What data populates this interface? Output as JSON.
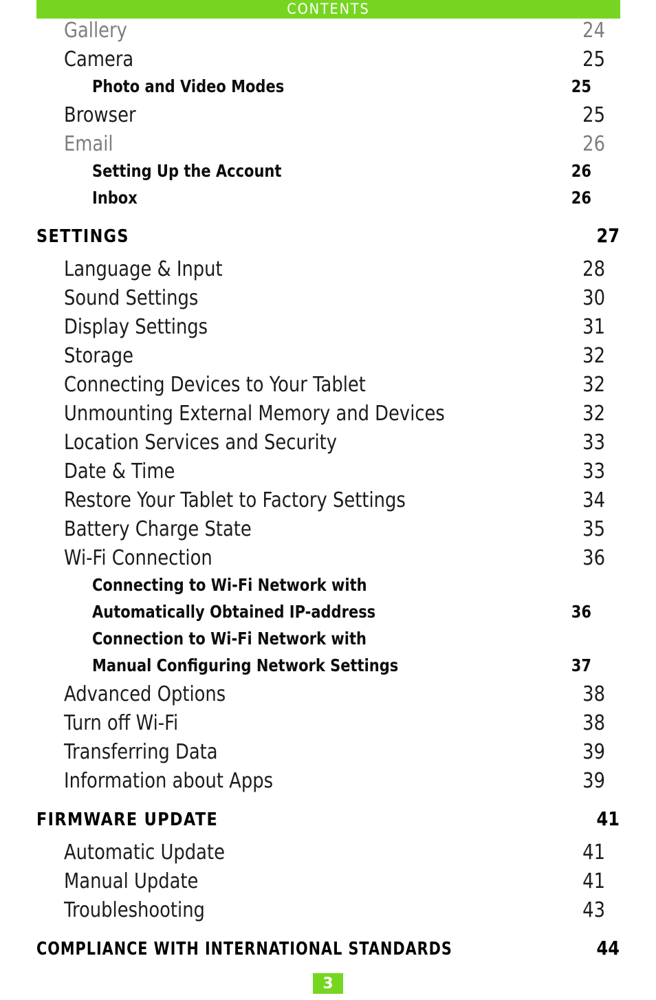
{
  "header": {
    "title": "CONTENTS",
    "bar_color": "#76d521",
    "text_color": "#ffffff"
  },
  "colors": {
    "accent_green": "#76d521",
    "text_dark": "#1c1c1c",
    "text_muted": "#7e7e7e",
    "badge_text": "#ffffff"
  },
  "entries": [
    {
      "level": 1,
      "label": "Gallery",
      "page": "24",
      "muted": true
    },
    {
      "level": 1,
      "label": "Camera",
      "page": "25",
      "muted": false
    },
    {
      "level": 2,
      "label": "Photo and Video Modes",
      "page": "25"
    },
    {
      "level": 1,
      "label": "Browser",
      "page": "25",
      "muted": false
    },
    {
      "level": 1,
      "label": "Email",
      "page": "26",
      "muted": true
    },
    {
      "level": 2,
      "label": "Setting Up the Account",
      "page": "26"
    },
    {
      "level": 2,
      "label": "Inbox",
      "page": "26"
    },
    {
      "level": 0,
      "label": "SETTINGS",
      "page": "27"
    },
    {
      "level": 1,
      "label": "Language & Input",
      "page": "28",
      "muted": false
    },
    {
      "level": 1,
      "label": "Sound Settings",
      "page": "30",
      "muted": false
    },
    {
      "level": 1,
      "label": "Display Settings",
      "page": "31",
      "muted": false
    },
    {
      "level": 1,
      "label": "Storage",
      "page": "32",
      "muted": false
    },
    {
      "level": 1,
      "label": "Connecting Devices to Your Tablet",
      "page": "32",
      "muted": false
    },
    {
      "level": 1,
      "label": "Unmounting External Memory and Devices",
      "page": "32",
      "muted": false
    },
    {
      "level": 1,
      "label": "Location Services and Security",
      "page": "33",
      "muted": false
    },
    {
      "level": 1,
      "label": "Date & Time",
      "page": "33",
      "muted": false
    },
    {
      "level": 1,
      "label": "Restore Your Tablet to Factory Settings",
      "page": "34",
      "muted": false
    },
    {
      "level": 1,
      "label": "Battery Charge State",
      "page": "35",
      "muted": false
    },
    {
      "level": 1,
      "label": "Wi-Fi Connection",
      "page": "36",
      "muted": false
    },
    {
      "level": 2,
      "label_line1": "Connecting to Wi-Fi Network with",
      "label_line2": "Automatically Obtained IP-address",
      "page": "36",
      "two_line": true
    },
    {
      "level": 2,
      "label_line1": "Connection to Wi-Fi Network with",
      "label_line2": "Manual Configuring Network Settings",
      "page": "37",
      "two_line": true
    },
    {
      "level": 1,
      "label": "Advanced Options",
      "page": "38",
      "muted": false
    },
    {
      "level": 1,
      "label": "Turn off Wi-Fi",
      "page": "38",
      "muted": false
    },
    {
      "level": 1,
      "label": "Transferring Data",
      "page": "39",
      "muted": false
    },
    {
      "level": 1,
      "label": "Information about Apps",
      "page": "39",
      "muted": false
    },
    {
      "level": 0,
      "label": "FIRMWARE UPDATE",
      "page": "41"
    },
    {
      "level": 1,
      "label": "Automatic Update",
      "page": "41",
      "muted": false
    },
    {
      "level": 1,
      "label": "Manual Update",
      "page": "41",
      "muted": false
    },
    {
      "level": 1,
      "label": "Troubleshooting",
      "page": "43",
      "muted": false
    },
    {
      "level": 0,
      "label": "COMPLIANCE WITH INTERNATIONAL STANDARDS",
      "page": "44",
      "wide": true
    }
  ],
  "footer": {
    "page_number": "3"
  }
}
